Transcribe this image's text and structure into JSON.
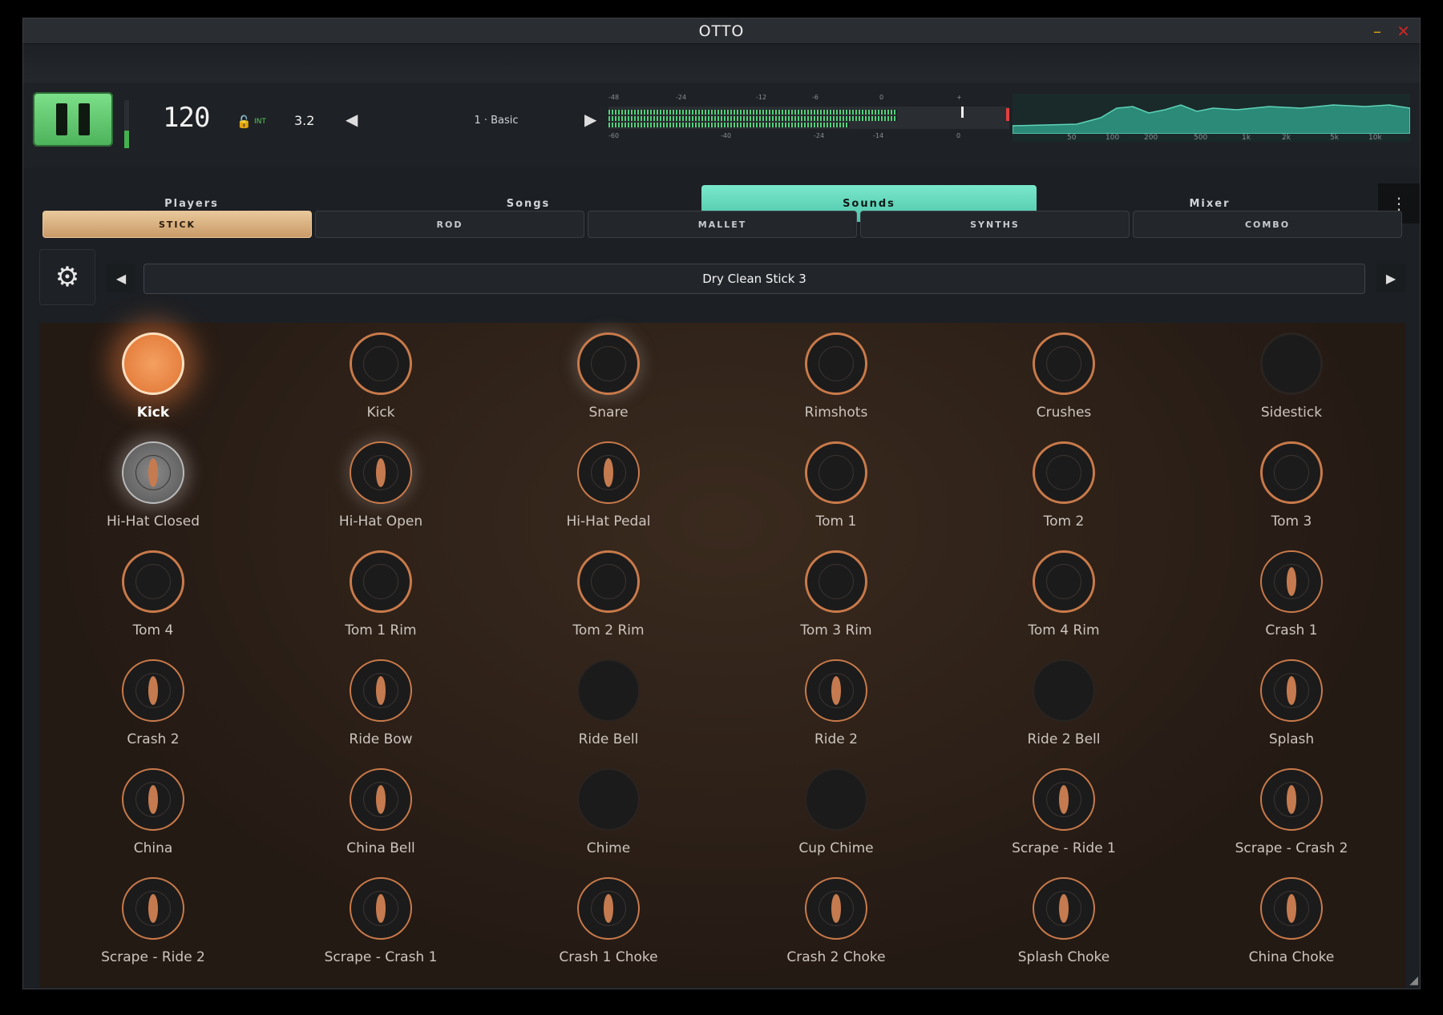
{
  "window": {
    "title": "OTTO",
    "min": "–",
    "close": "✕"
  },
  "transport": {
    "tempo": "120",
    "sync": "INT",
    "swing": "3.2",
    "pattern": "1 · Basic",
    "meter_scale_top": [
      "-48",
      "-24",
      "-12",
      "-6",
      "0",
      "+"
    ],
    "meter_scale_bottom": [
      "-60",
      "-40",
      "-24",
      "-14",
      "0"
    ],
    "freq_labels": [
      "50",
      "100",
      "200",
      "500",
      "1k",
      "2k",
      "5k",
      "10k"
    ]
  },
  "tabs": [
    "Players",
    "Songs",
    "Sounds",
    "Mixer"
  ],
  "active_tab": "Sounds",
  "sub_tabs": [
    "STICK",
    "ROD",
    "MALLET",
    "SYNTHS",
    "COMBO"
  ],
  "active_sub_tab": "STICK",
  "kit": {
    "name": "Dry Clean Stick 3"
  },
  "pads": [
    [
      "Kick",
      "Kick",
      "Snare",
      "Rimshots",
      "Crushes",
      "Sidestick"
    ],
    [
      "Hi-Hat Closed",
      "Hi-Hat Open",
      "Hi-Hat Pedal",
      "Tom 1",
      "Tom 2",
      "Tom 3"
    ],
    [
      "Tom 4",
      "Tom 1 Rim",
      "Tom 2 Rim",
      "Tom 3 Rim",
      "Tom 4 Rim",
      "Crash 1"
    ],
    [
      "Crash 2",
      "Ride Bow",
      "Ride Bell",
      "Ride 2",
      "Ride 2 Bell",
      "Splash"
    ],
    [
      "China",
      "China Bell",
      "Chime",
      "Cup Chime",
      "Scrape - Ride 1",
      "Scrape - Crash 2"
    ],
    [
      "Scrape - Ride 2",
      "Scrape - Crash 1",
      "Crash 1 Choke",
      "Crash 2 Choke",
      "Splash Choke",
      "China Choke"
    ]
  ]
}
